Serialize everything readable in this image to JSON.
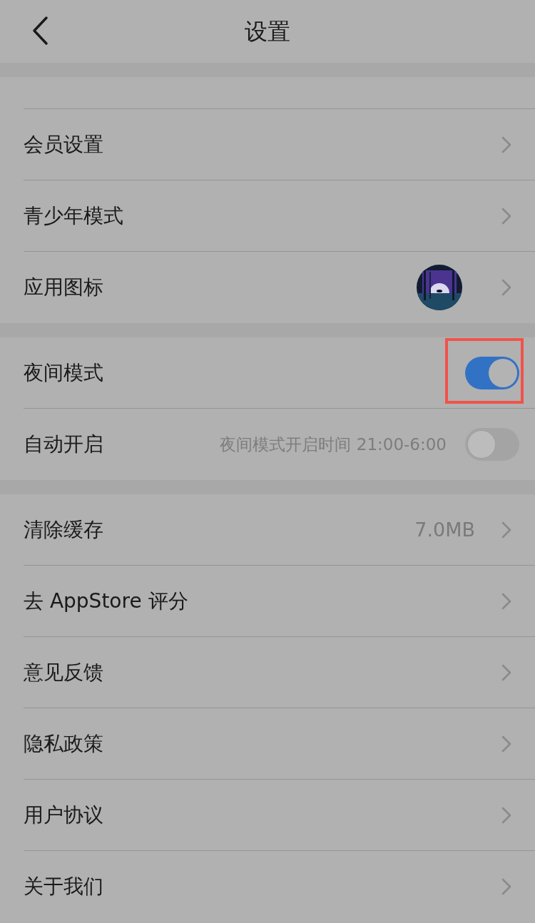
{
  "header": {
    "title": "设置"
  },
  "sections": [
    {
      "rows": [
        {
          "kind": "link",
          "label": "会员设置"
        },
        {
          "kind": "link",
          "label": "青少年模式"
        },
        {
          "label": "应用图标"
        }
      ]
    },
    {
      "rows": [
        {
          "kind": "toggle",
          "label": "夜间模式",
          "on": true,
          "highlighted": true
        },
        {
          "kind": "toggle",
          "label": "自动开启",
          "note": "夜间模式开启时间 21:00-6:00",
          "on": false,
          "highlighted": false
        }
      ]
    },
    {
      "rows": [
        {
          "kind": "link",
          "label": "清除缓存",
          "value": "7.0MB"
        },
        {
          "kind": "link",
          "label": "去 AppStore 评分"
        },
        {
          "kind": "link",
          "label": "意见反馈"
        },
        {
          "kind": "link",
          "label": "隐私政策"
        },
        {
          "kind": "link",
          "label": "用户协议"
        },
        {
          "kind": "link",
          "label": "关于我们"
        }
      ]
    }
  ]
}
